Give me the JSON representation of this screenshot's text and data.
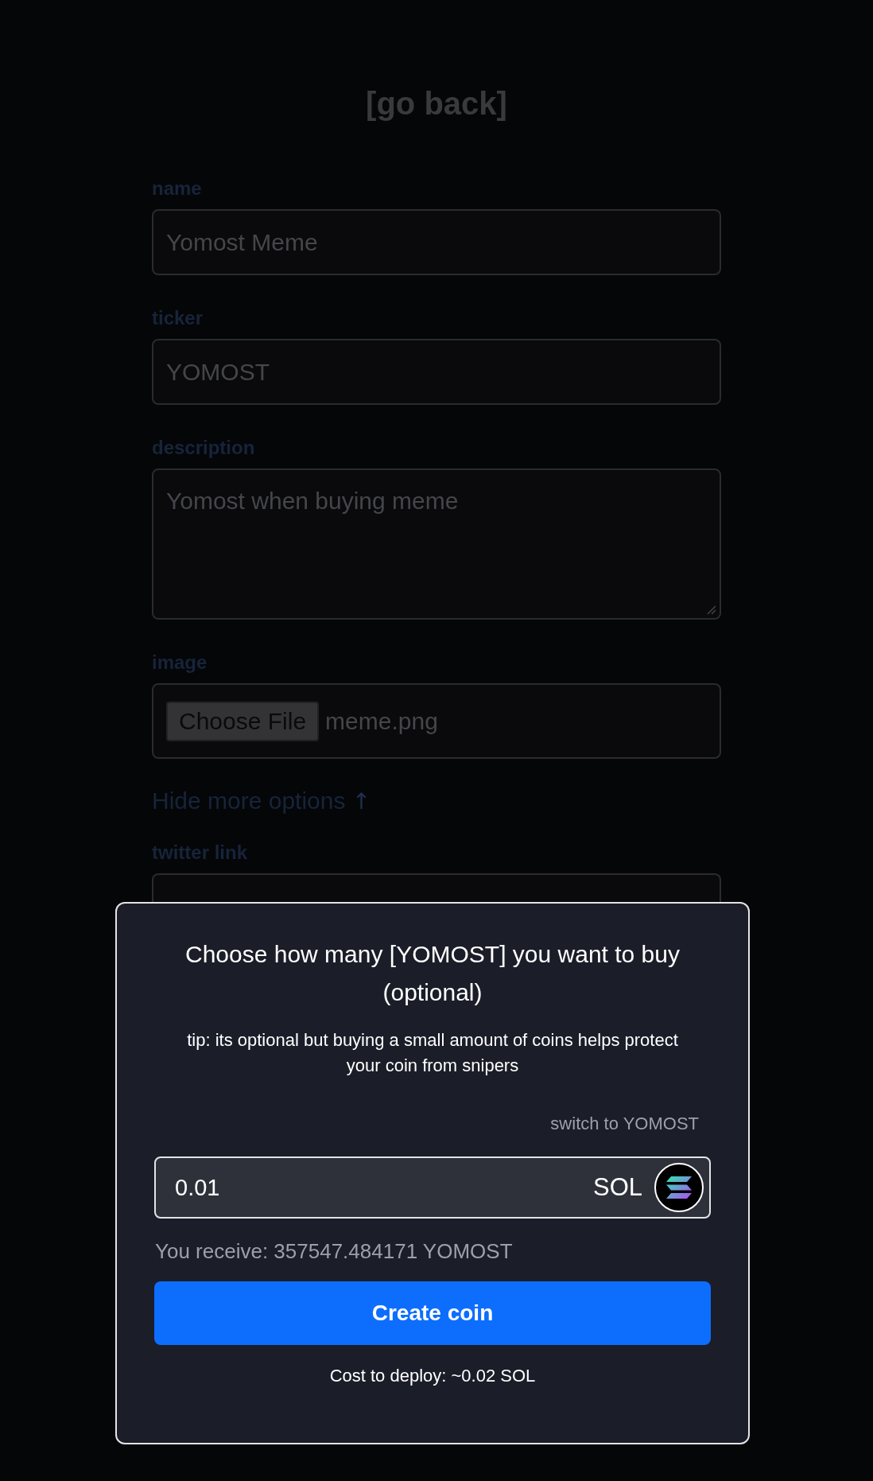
{
  "back_link": "[go back]",
  "fields": [
    {
      "kind": "text",
      "label": "name",
      "value": "Yomost Meme"
    },
    {
      "kind": "text",
      "label": "ticker",
      "value": "YOMOST"
    },
    {
      "kind": "textarea",
      "label": "description",
      "value": "Yomost when buying meme"
    },
    {
      "kind": "file",
      "label": "image",
      "button": "Choose File",
      "value": "meme.png"
    }
  ],
  "toggle_options": {
    "label": "Hide more options",
    "arrow": "↑"
  },
  "extra_fields": [
    {
      "kind": "text",
      "label": "twitter link"
    }
  ],
  "modal": {
    "title": "Choose how many [YOMOST] you want to buy (optional)",
    "tip": "tip: its optional but buying a small amount of coins helps protect your coin from snipers",
    "switch_link": "switch to YOMOST",
    "amount": {
      "value": "0.01",
      "currency": "SOL"
    },
    "receive": "You receive: 357547.484171 YOMOST",
    "create_button": "Create coin",
    "cost": "Cost to deploy: ~0.02 SOL"
  }
}
